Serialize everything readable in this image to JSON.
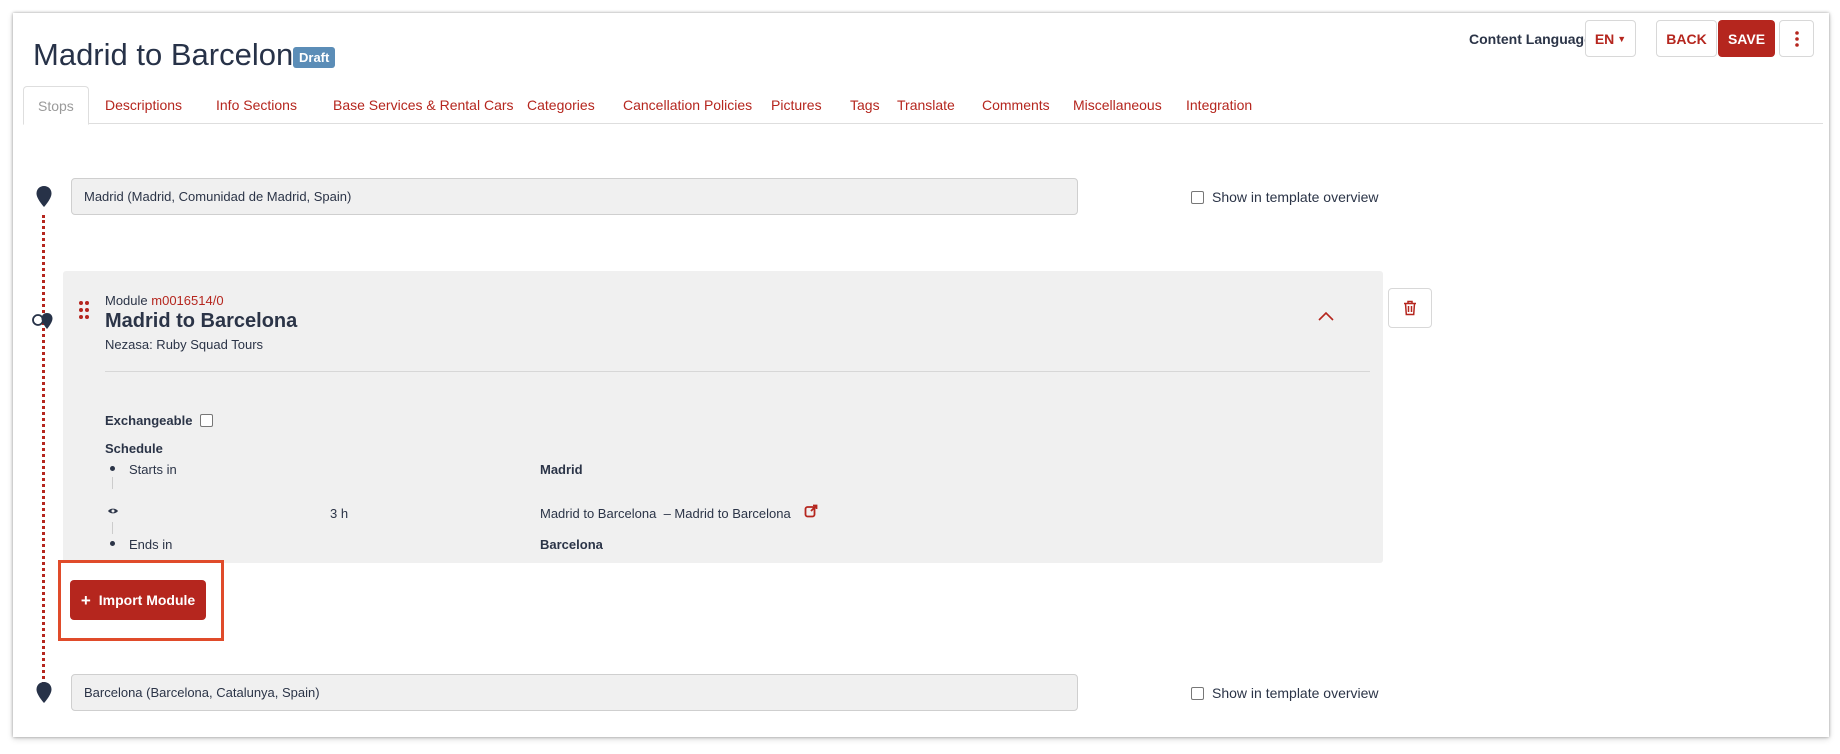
{
  "header": {
    "title": "Madrid to Barcelona",
    "status_badge": "Draft",
    "content_language_label": "Content Language",
    "language_value": "EN",
    "back_label": "BACK",
    "save_label": "SAVE"
  },
  "tabs": [
    {
      "label": "Stops",
      "active": true
    },
    {
      "label": "Descriptions"
    },
    {
      "label": "Info Sections"
    },
    {
      "label": "Base Services & Rental Cars"
    },
    {
      "label": "Categories"
    },
    {
      "label": "Cancellation Policies"
    },
    {
      "label": "Pictures"
    },
    {
      "label": "Tags"
    },
    {
      "label": "Translate"
    },
    {
      "label": "Comments"
    },
    {
      "label": "Miscellaneous"
    },
    {
      "label": "Integration"
    }
  ],
  "stops": {
    "start": {
      "value": "Madrid (Madrid, Comunidad de Madrid, Spain)",
      "show_in_overview_label": "Show in template overview"
    },
    "end": {
      "value": "Barcelona (Barcelona, Catalunya, Spain)",
      "show_in_overview_label": "Show in template overview"
    }
  },
  "module": {
    "prefix": "Module",
    "code": "m0016514/0",
    "title": "Madrid to Barcelona",
    "provider": "Nezasa: Ruby Squad Tours",
    "exchangeable_label": "Exchangeable",
    "schedule_label": "Schedule",
    "schedule": {
      "starts_label": "Starts in",
      "starts_value": "Madrid",
      "duration": "3 h",
      "transfer": "Madrid to Barcelona  – Madrid to Barcelona",
      "ends_label": "Ends in",
      "ends_value": "Barcelona"
    }
  },
  "actions": {
    "import_module_label": "Import Module"
  },
  "colors": {
    "accent": "#b5261e",
    "badge": "#5b8db7",
    "highlight_frame": "#e04b2a"
  }
}
